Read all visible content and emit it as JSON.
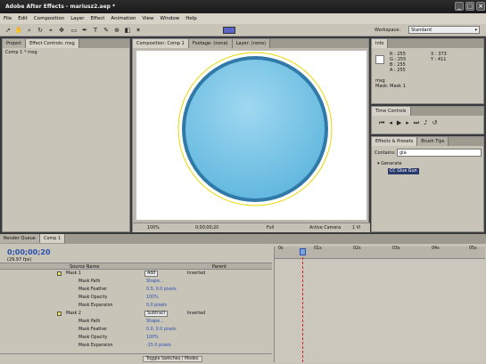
{
  "window": {
    "title": "Adobe After Effects - mariusz2.aep *"
  },
  "menu": [
    "File",
    "Edit",
    "Composition",
    "Layer",
    "Effect",
    "Animation",
    "View",
    "Window",
    "Help"
  ],
  "workspace": {
    "label": "Workspace:",
    "value": "Standard"
  },
  "project_panel": {
    "tabs": [
      "Project",
      "Effect Controls: msg"
    ],
    "item": "Comp 1 * msg"
  },
  "comp_panel": {
    "tabs": [
      "Composition: Comp 1",
      "Footage: (none)",
      "Layer: (none)"
    ],
    "zoom": "100%",
    "timecode": "0;00;00;20",
    "resolution": "Full",
    "camera": "Active Camera",
    "views": "1 Vi"
  },
  "info_panel": {
    "tab": "Info",
    "r": "R : 255",
    "g": "G : 255",
    "b": "B : 255",
    "a": "A : 255",
    "x": "X : 373",
    "y": "Y : 411",
    "layer": "msg",
    "mask": "Mask: Mask 1"
  },
  "time_controls": {
    "tab": "Time Controls"
  },
  "effects_panel": {
    "tabs": [
      "Effects & Presets",
      "Brush Tips"
    ],
    "contains_label": "Contains:",
    "contains_value": "gla",
    "category": "Generate",
    "effect": "CC Glue Gun"
  },
  "timeline": {
    "tabs": [
      "Render Queue",
      "Comp 1"
    ],
    "timecode": "0;00;00;20",
    "fps": "(29.97 fps)",
    "source_col": "Source Name",
    "parent_col": "Parent",
    "toggle": "Toggle Switches / Modes",
    "ruler": [
      "0s",
      "01s",
      "02s",
      "03s",
      "04s",
      "05s"
    ],
    "rows": [
      {
        "name": "Mask 1",
        "mode": "Add",
        "inv": "Inverted"
      },
      {
        "name": "Mask Path",
        "value": "Shape..."
      },
      {
        "name": "Mask Feather",
        "value": "0.0, 0.0 pixels"
      },
      {
        "name": "Mask Opacity",
        "value": "100%"
      },
      {
        "name": "Mask Expansion",
        "value": "0.0 pixels"
      },
      {
        "name": "Mask 2",
        "mode": "Subtract",
        "inv": "Inverted"
      },
      {
        "name": "Mask Path",
        "value": "Shape..."
      },
      {
        "name": "Mask Feather",
        "value": "0.0, 0.0 pixels"
      },
      {
        "name": "Mask Opacity",
        "value": "100%"
      },
      {
        "name": "Mask Expansion",
        "value": "-15.0 pixels"
      }
    ]
  }
}
